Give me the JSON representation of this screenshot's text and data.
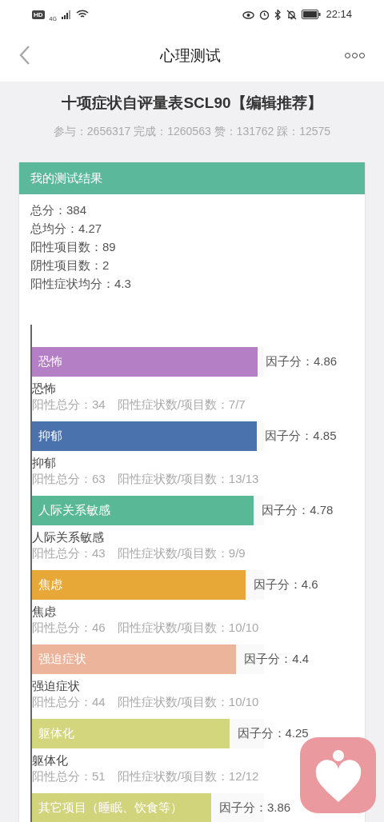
{
  "status_bar": {
    "hd": "HD",
    "network": "4G",
    "time": "22:14"
  },
  "header": {
    "title": "心理测试"
  },
  "test": {
    "title": "十项症状自评量表SCL90【编辑推荐】",
    "stats": "参与：2656317 完成：1260563 赞：131762 踩：12575"
  },
  "result_card": {
    "title": "我的测试结果",
    "summary": [
      "总分：384",
      "总均分：4.27",
      "阳性项目数：89",
      "阴性项目数：2",
      "阳性症状均分：4.3"
    ],
    "factors": [
      {
        "bar_label": "恐怖",
        "score": "因子分：4.86",
        "level": 0.972,
        "color": "#b57fc6",
        "name": "恐怖",
        "detail": "阳性总分：34　阳性症状数/项目数：7/7"
      },
      {
        "bar_label": "抑郁",
        "score": "因子分：4.85",
        "level": 0.97,
        "color": "#4a72ad",
        "name": "抑郁",
        "detail": "阳性总分：63　阳性症状数/项目数：13/13"
      },
      {
        "bar_label": "人际关系敏感",
        "score": "因子分：4.78",
        "level": 0.956,
        "color": "#59b896",
        "name": "人际关系敏感",
        "detail": "阳性总分：43　阳性症状数/项目数：9/9"
      },
      {
        "bar_label": "焦虑",
        "score": "因子分：4.6",
        "level": 0.92,
        "color": "#e8a838",
        "name": "焦虑",
        "detail": "阳性总分：46　阳性症状数/项目数：10/10"
      },
      {
        "bar_label": "强迫症状",
        "score": "因子分：4.4",
        "level": 0.88,
        "color": "#ecb49a",
        "name": "强迫症状",
        "detail": "阳性总分：44　阳性症状数/项目数：10/10"
      },
      {
        "bar_label": "躯体化",
        "score": "因子分：4.25",
        "level": 0.85,
        "color": "#d4d67e",
        "name": "躯体化",
        "detail": "阳性总分：51　阳性症状数/项目数：12/12"
      },
      {
        "bar_label": "其它项目（睡眠、饮食等）",
        "score": "因子分：3.86",
        "level": 0.772,
        "color": "#d2d47c"
      }
    ]
  }
}
